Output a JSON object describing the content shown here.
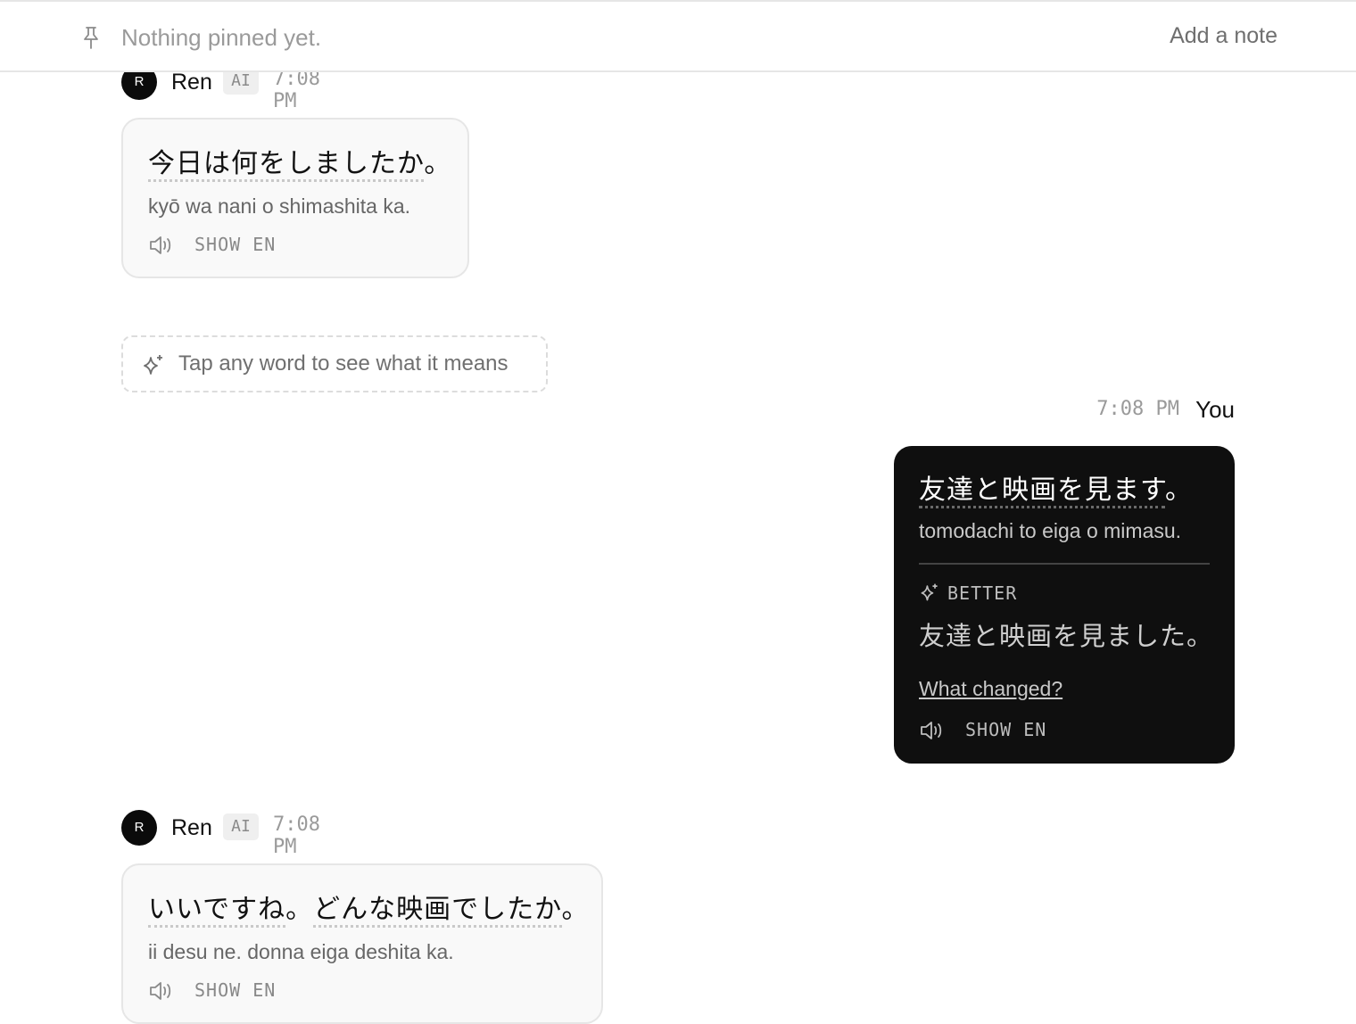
{
  "pinned": {
    "placeholder": "Nothing pinned yet.",
    "add_note": "Add a note"
  },
  "hint": "Tap any word to see what it means",
  "messages": [
    {
      "sender": "Ren",
      "avatar": "R",
      "badge": "AI",
      "time": "7:08 PM",
      "words": [
        "今日は何をしましたか",
        "。"
      ],
      "romaji": "kyō wa nani o shimashita ka.",
      "show_en": "SHOW EN"
    },
    {
      "sender": "You",
      "time": "7:08 PM",
      "words": [
        "友達と映画を見ます",
        "。"
      ],
      "romaji": "tomodachi to eiga o mimasu.",
      "better_label": "BETTER",
      "better_text": "友達と映画を見ました。",
      "what_changed": "What changed?",
      "show_en": "SHOW EN"
    },
    {
      "sender": "Ren",
      "avatar": "R",
      "badge": "AI",
      "time": "7:08 PM",
      "words": [
        "いいですね",
        "。",
        "どんな映画でしたか",
        "。"
      ],
      "romaji": "ii desu ne. donna eiga deshita ka.",
      "show_en": "SHOW EN"
    }
  ],
  "icons": {
    "pin": "pin-icon",
    "speaker": "speaker-icon",
    "sparkle": "sparkle-icon"
  },
  "colors": {
    "user_bubble": "#0f0f0f",
    "ai_bubble": "#f9f9f9",
    "avatar": "#0b0b0b"
  }
}
